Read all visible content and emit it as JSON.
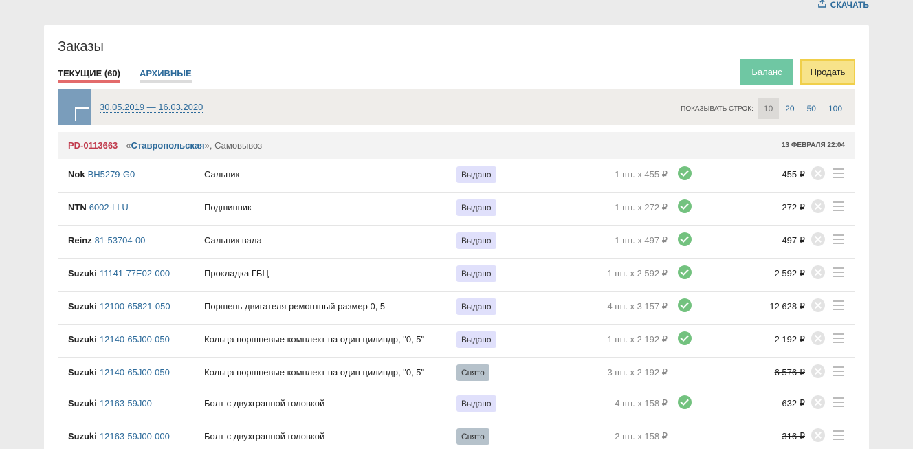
{
  "topbar": {
    "download_label": "СКАЧАТЬ"
  },
  "page": {
    "title": "Заказы"
  },
  "tabs": [
    {
      "label": "ТЕКУЩИЕ (60)"
    },
    {
      "label": "АРХИВНЫЕ"
    }
  ],
  "actions": {
    "balance_label": "Баланс",
    "sell_label": "Продать"
  },
  "filter": {
    "date_range": "30.05.2019 — 16.03.2020",
    "rows_label": "ПОКАЗЫВАТЬ СТРОК:",
    "rows_options": [
      "10",
      "20",
      "50",
      "100"
    ],
    "rows_selected": "10"
  },
  "order": {
    "id": "PD-0113663",
    "store_open": "«",
    "store": "Ставропольская",
    "store_close": "»",
    "delivery": ", Самовывоз",
    "date": "13 ФЕВРАЛЯ 22:04"
  },
  "items": [
    {
      "brand": "Nok",
      "part": "BH5279-G0",
      "desc": "Сальник",
      "status": "Выдано",
      "qty": "1 шт. х 455 ₽",
      "confirmed": true,
      "total": "455 ₽",
      "cancelled": false
    },
    {
      "brand": "NTN",
      "part": "6002-LLU",
      "desc": "Подшипник",
      "status": "Выдано",
      "qty": "1 шт. х 272 ₽",
      "confirmed": true,
      "total": "272 ₽",
      "cancelled": false
    },
    {
      "brand": "Reinz",
      "part": "81-53704-00",
      "desc": "Сальник вала",
      "status": "Выдано",
      "qty": "1 шт. х 497 ₽",
      "confirmed": true,
      "total": "497 ₽",
      "cancelled": false
    },
    {
      "brand": "Suzuki",
      "part": "11141-77E02-000",
      "desc": "Прокладка ГБЦ",
      "status": "Выдано",
      "qty": "1 шт. х 2 592 ₽",
      "confirmed": true,
      "total": "2 592 ₽",
      "cancelled": false
    },
    {
      "brand": "Suzuki",
      "part": "12100-65821-050",
      "desc": "Поршень двигателя ремонтный размер 0, 5",
      "status": "Выдано",
      "qty": "4 шт. х 3 157 ₽",
      "confirmed": true,
      "total": "12 628 ₽",
      "cancelled": false
    },
    {
      "brand": "Suzuki",
      "part": "12140-65J00-050",
      "desc": "Кольца поршневые комплект на один цилиндр, \"0, 5\"",
      "status": "Выдано",
      "qty": "1 шт. х 2 192 ₽",
      "confirmed": true,
      "total": "2 192 ₽",
      "cancelled": false
    },
    {
      "brand": "Suzuki",
      "part": "12140-65J00-050",
      "desc": "Кольца поршневые комплект на один цилиндр, \"0, 5\"",
      "status": "Снято",
      "qty": "3 шт. х 2 192 ₽",
      "confirmed": false,
      "total": "6 576 ₽",
      "cancelled": true
    },
    {
      "brand": "Suzuki",
      "part": "12163-59J00",
      "desc": "Болт с двухгранной головкой",
      "status": "Выдано",
      "qty": "4 шт. х 158 ₽",
      "confirmed": true,
      "total": "632 ₽",
      "cancelled": false
    },
    {
      "brand": "Suzuki",
      "part": "12163-59J00-000",
      "desc": "Болт с двухгранной головкой",
      "status": "Снято",
      "qty": "2 шт. х 158 ₽",
      "confirmed": false,
      "total": "316 ₽",
      "cancelled": true
    }
  ]
}
